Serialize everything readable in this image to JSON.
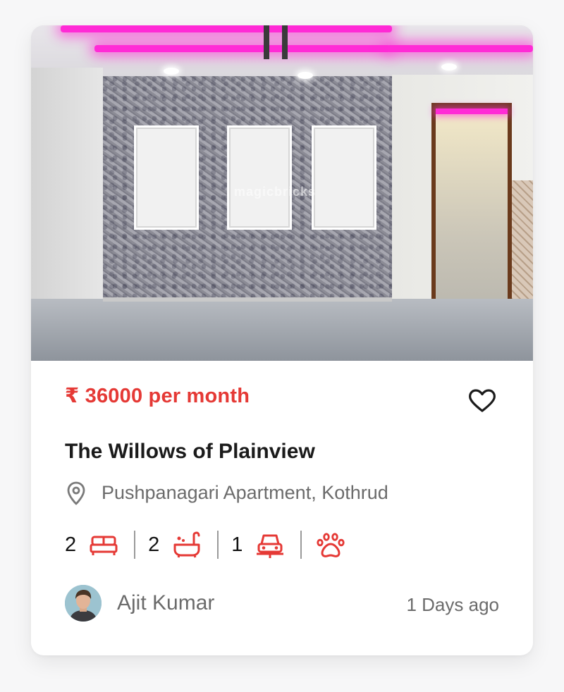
{
  "listing": {
    "price": "₹ 36000 per month",
    "title": "The Willows of Plainview",
    "location": "Pushpanagari Apartment, Kothrud",
    "image_watermark": "magicbricks"
  },
  "features": {
    "bedrooms": "2",
    "bathrooms": "2",
    "parking": "1"
  },
  "agent": {
    "name": "Ajit Kumar",
    "posted": "1 Days ago"
  },
  "icons": {
    "favorite": "heart-outline-icon",
    "location": "map-pin-icon",
    "bed": "bed-icon",
    "bath": "bathtub-icon",
    "parking": "car-icon",
    "pets": "paw-icon"
  },
  "colors": {
    "accent": "#e53935",
    "text_primary": "#1b1b1b",
    "text_secondary": "#6b6b6b"
  }
}
